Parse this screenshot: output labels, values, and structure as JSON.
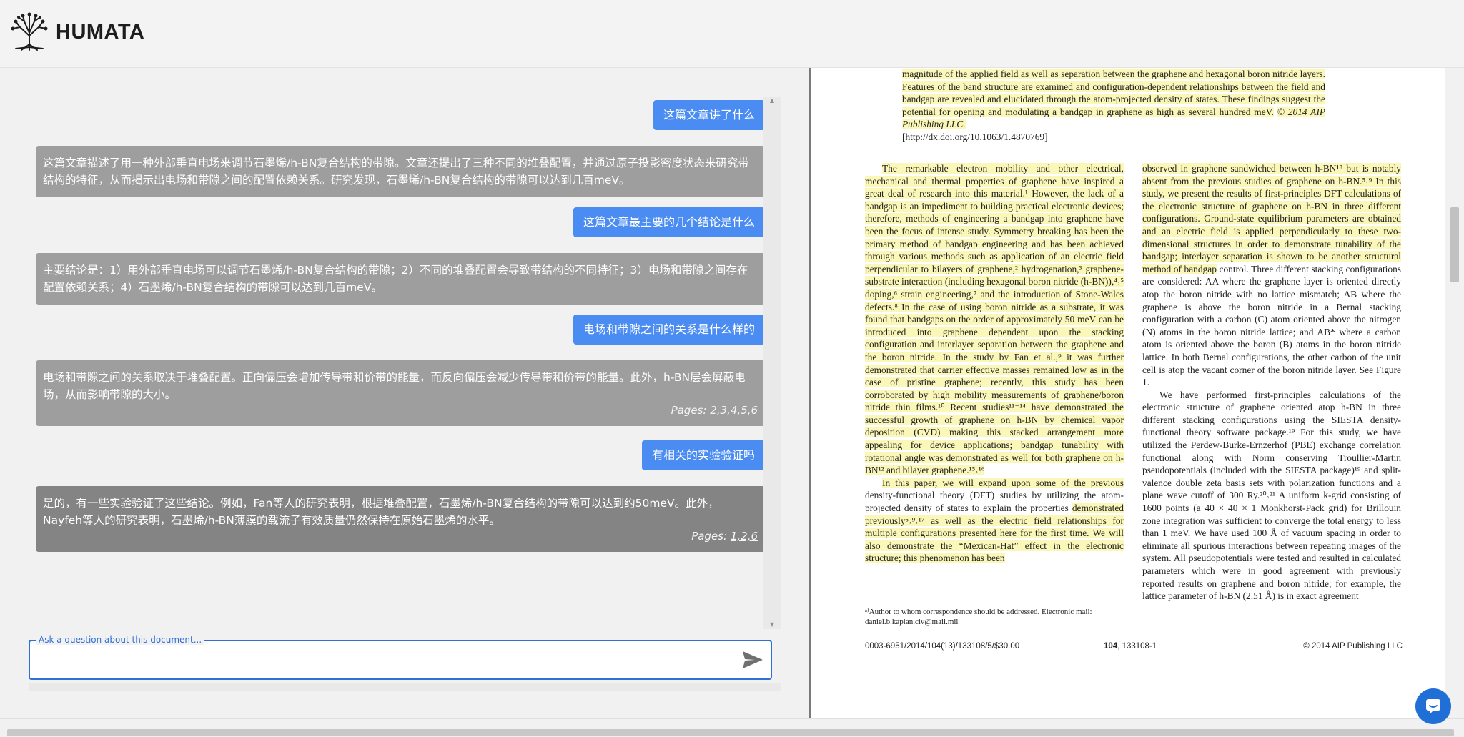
{
  "app": {
    "name": "HUMATA"
  },
  "chat": {
    "messages": [
      {
        "role": "user",
        "text": "这篇文章讲了什么"
      },
      {
        "role": "assistant",
        "text": "这篇文章描述了用一种外部垂直电场来调节石墨烯/h-BN复合结构的带隙。文章还提出了三种不同的堆叠配置，并通过原子投影密度状态来研究带结构的特征，从而揭示出电场和带隙之间的配置依赖关系。研究发现，石墨烯/h-BN复合结构的带隙可以达到几百meV。"
      },
      {
        "role": "user",
        "text": "这篇文章最主要的几个结论是什么"
      },
      {
        "role": "assistant",
        "text": "主要结论是：1）用外部垂直电场可以调节石墨烯/h-BN复合结构的带隙；2）不同的堆叠配置会导致带结构的不同特征；3）电场和带隙之间存在配置依赖关系；4）石墨烯/h-BN复合结构的带隙可以达到几百meV。"
      },
      {
        "role": "user",
        "text": "电场和带隙之间的关系是什么样的"
      },
      {
        "role": "assistant",
        "text": "电场和带隙之间的关系取决于堆叠配置。正向偏压会增加传导带和价带的能量，而反向偏压会减少传导带和价带的能量。此外，h-BN层会屏蔽电场，从而影响带隙的大小。",
        "pages_label": "Pages:",
        "pages": "2,3,4,5,6"
      },
      {
        "role": "user",
        "text": "有相关的实验验证吗"
      },
      {
        "role": "assistant",
        "text": "是的，有一些实验验证了这些结论。例如，Fan等人的研究表明，根据堆叠配置，石墨烯/h-BN复合结构的带隙可以达到约50meV。此外，Nayfeh等人的研究表明，石墨烯/h-BN薄膜的载流子有效质量仍然保持在原始石墨烯的水平。",
        "pages_label": "Pages:",
        "pages": "1,2,6"
      }
    ],
    "input": {
      "label": "Ask a question about this document...",
      "value": "",
      "placeholder": ""
    }
  },
  "document": {
    "abstract_lines": "magnitude of the applied field as well as separation between the graphene and hexagonal boron nitride layers. Features of the band structure are examined and configuration-dependent relationships between the field and bandgap are revealed and elucidated through the atom-projected density of states. These findings suggest the potential for opening and modulating a bandgap in graphene as high as several hundred meV.",
    "copyright_italic": "© 2014 AIP Publishing LLC.",
    "doi": "[http://dx.doi.org/10.1063/1.4870769]",
    "left_p1": "The remarkable electron mobility and other electrical, mechanical and thermal properties of graphene have inspired a great deal of research into this material.¹ However, the lack of a bandgap is an impediment to building practical electronic devices; therefore, methods of engineering a bandgap into graphene have been the focus of intense study. Symmetry breaking has been the primary method of bandgap engineering and has been achieved through various methods such as application of an electric field perpendicular to bilayers of graphene,² hydrogenation,³ graphene-substrate interaction (including hexagonal boron nitride (h-BN)),⁴˒⁵ doping,⁶ strain engineering,⁷ and the introduction of Stone-Wales defects.⁸ In the case of using boron nitride as a substrate, it was found that bandgaps on the order of approximately 50 meV can be introduced into graphene dependent upon the stacking configuration and interlayer separation between the graphene and the boron nitride. In the study by Fan et al.,⁹ it was further demonstrated that carrier effective masses remained low as in the case of pristine graphene; recently, this study has been corroborated by high mobility measurements of graphene/boron nitride thin films.¹⁰ Recent studies¹¹⁻¹⁴ have demonstrated the successful growth of graphene on h-BN by chemical vapor deposition (CVD) making this stacked arrangement more appealing for device applications; bandgap tunability with rotational angle was demonstrated as well for both graphene on h-BN¹² and bilayer graphene.¹⁵˒¹⁶",
    "left_p2_hl": "In this paper, we will expand upon some of the previous",
    "left_p2_plain": "density-functional theory (DFT) studies by utilizing the atom-projected density of states to explain the properties",
    "left_p2_hl2": "demonstrated previously⁵˒⁹˒¹⁷ as well as the electric field relationships for multiple configurations presented here for the first time. We will also demonstrate the “Mexican-Hat” effect in the electronic structure; this phenomenon has been",
    "right_p1_hl": "observed in graphene sandwiched between h-BN¹⁸ but is notably absent from the previous studies of graphene on h-BN.⁵˒⁹ In this study, we present the results of first-principles DFT calculations of the electronic structure of graphene on h-BN in three different configurations. Ground-state equilibrium parameters are obtained and an electric field is applied perpendicularly to these two-dimensional structures in order to demonstrate tunability of the bandgap; interlayer separation is shown to be another structural method of bandgap",
    "right_p1_plain": "control. Three different stacking configurations are considered: AA where the graphene layer is oriented directly atop the boron nitride with no lattice mismatch; AB where the graphene is above the boron nitride in a Bernal stacking configuration with a carbon (C) atom oriented above the nitrogen (N) atoms in the boron nitride lattice; and AB* where a carbon atom is oriented above the boron (B) atoms in the boron nitride lattice. In both Bernal configurations, the other carbon of the unit cell is atop the vacant corner of the boron nitride layer. See Figure 1.",
    "right_p2": "We have performed first-principles calculations of the electronic structure of graphene oriented atop h-BN in three different stacking configurations using the SIESTA density-functional theory software package.¹⁹ For this study, we have utilized the Perdew-Burke-Ernzerhof (PBE) exchange correlation functional along with Norm conserving Troullier-Martin pseudopotentials (included with the SIESTA package)¹⁹ and split-valence double zeta basis sets with polarization functions and a plane wave cutoff of 300 Ry.²⁰˒²¹ A uniform k-grid consisting of 1600 points (a 40 × 40 × 1 Monkhorst-Pack grid) for Brillouin zone integration was sufficient to converge the total energy to less than 1 meV. We have used 100 Å of vacuum spacing in order to eliminate all spurious interactions between repeating images of the system. All pseudopotentials were tested and resulted in calculated parameters which were in good agreement with previously reported results on graphene and boron nitride; for example, the lattice parameter of h-BN (2.51 Å) is in exact agreement",
    "footnote": "ᵃ⁾Author to whom correspondence should be addressed. Electronic mail: daniel.b.kaplan.civ@mail.mil",
    "footer_left": "0003-6951/2014/104(13)/133108/5/$30.00",
    "footer_center_bold": "104",
    "footer_center": ", 133108-1",
    "footer_right": "© 2014 AIP Publishing LLC"
  },
  "colors": {
    "user_bubble": "#4a8cf1",
    "assistant_bubble": "#9e9e9e",
    "highlight": "#fbf7b8",
    "accent": "#2f6fd6"
  }
}
